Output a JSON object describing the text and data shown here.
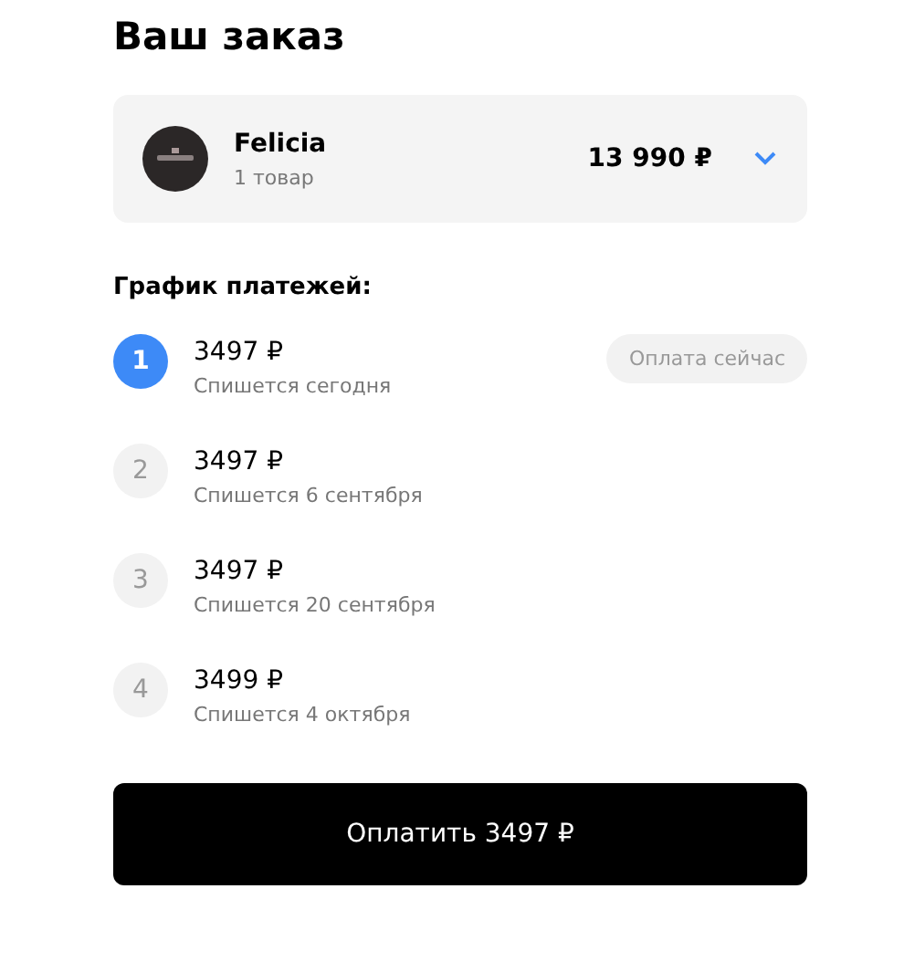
{
  "title": "Ваш заказ",
  "order": {
    "shop": "Felicia",
    "items": "1 товар",
    "total": "13 990 ₽",
    "expanded": false
  },
  "schedule": {
    "heading": "График платежей:",
    "steps": [
      {
        "number": "1",
        "amount": "3497 ₽",
        "note": "Спишется сегодня",
        "selected": true,
        "badge": "Оплата сейчас"
      },
      {
        "number": "2",
        "amount": "3497 ₽",
        "note": "Спишется 6 сентября",
        "selected": false
      },
      {
        "number": "3",
        "amount": "3497 ₽",
        "note": "Спишется 20 сентября",
        "selected": false
      },
      {
        "number": "4",
        "amount": "3499 ₽",
        "note": "Спишется 4 октября",
        "selected": false
      }
    ]
  },
  "pay_button": "Оплатить 3497 ₽"
}
